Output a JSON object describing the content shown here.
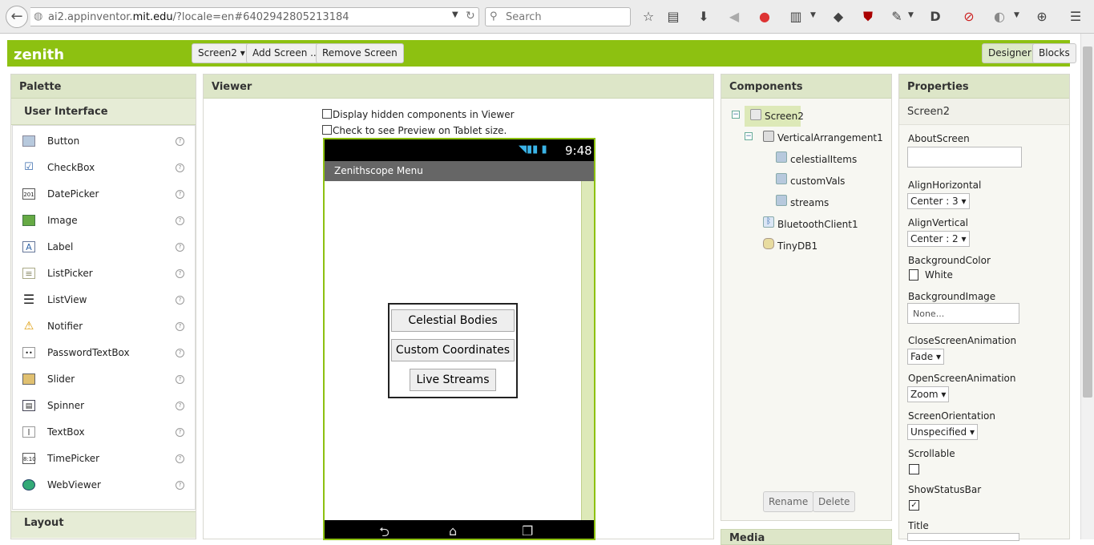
{
  "browser": {
    "url_prefix": "ai2.appinventor.",
    "url_domain": "mit.edu",
    "url_suffix": "/?locale=en#6402942805213184",
    "search_placeholder": "Search"
  },
  "header": {
    "app_name": "zenith",
    "screen_selector": "Screen2 ▾",
    "add_screen": "Add Screen ...",
    "remove_screen": "Remove Screen",
    "designer": "Designer",
    "blocks": "Blocks"
  },
  "palette": {
    "title": "Palette",
    "section": "User Interface",
    "items": [
      {
        "label": "Button",
        "icon": "button-icon"
      },
      {
        "label": "CheckBox",
        "icon": "checkbox-icon"
      },
      {
        "label": "DatePicker",
        "icon": "datepicker-icon"
      },
      {
        "label": "Image",
        "icon": "image-icon"
      },
      {
        "label": "Label",
        "icon": "label-icon"
      },
      {
        "label": "ListPicker",
        "icon": "listpicker-icon"
      },
      {
        "label": "ListView",
        "icon": "listview-icon"
      },
      {
        "label": "Notifier",
        "icon": "notifier-icon"
      },
      {
        "label": "PasswordTextBox",
        "icon": "password-icon"
      },
      {
        "label": "Slider",
        "icon": "slider-icon"
      },
      {
        "label": "Spinner",
        "icon": "spinner-icon"
      },
      {
        "label": "TextBox",
        "icon": "textbox-icon"
      },
      {
        "label": "TimePicker",
        "icon": "timepicker-icon"
      },
      {
        "label": "WebViewer",
        "icon": "webviewer-icon"
      }
    ],
    "help": "?",
    "layout_section": "Layout"
  },
  "viewer": {
    "title": "Viewer",
    "hidden_check": "Display hidden components in Viewer",
    "tablet_check": "Check to see Preview on Tablet size.",
    "time": "9:48",
    "screen_title": "Zenithscope Menu",
    "buttons": [
      "Celestial Bodies",
      "Custom Coordinates",
      "Live Streams"
    ]
  },
  "components": {
    "title": "Components",
    "tree": {
      "screen": "Screen2",
      "arrangement": "VerticalArrangement1",
      "children": [
        "celestialItems",
        "customVals",
        "streams"
      ],
      "bluetooth": "BluetoothClient1",
      "tinydb": "TinyDB1"
    },
    "rename": "Rename",
    "delete": "Delete",
    "media": "Media"
  },
  "properties": {
    "title": "Properties",
    "screen": "Screen2",
    "about_label": "AboutScreen",
    "align_h_label": "AlignHorizontal",
    "align_h": "Center : 3 ▾",
    "align_v_label": "AlignVertical",
    "align_v": "Center : 2 ▾",
    "bg_color_label": "BackgroundColor",
    "bg_color": "White",
    "bg_image_label": "BackgroundImage",
    "bg_image": "None...",
    "close_anim_label": "CloseScreenAnimation",
    "close_anim": "Fade ▾",
    "open_anim_label": "OpenScreenAnimation",
    "open_anim": "Zoom ▾",
    "orientation_label": "ScreenOrientation",
    "orientation": "Unspecified ▾",
    "scrollable_label": "Scrollable",
    "statusbar_label": "ShowStatusBar",
    "title_label": "Title"
  }
}
